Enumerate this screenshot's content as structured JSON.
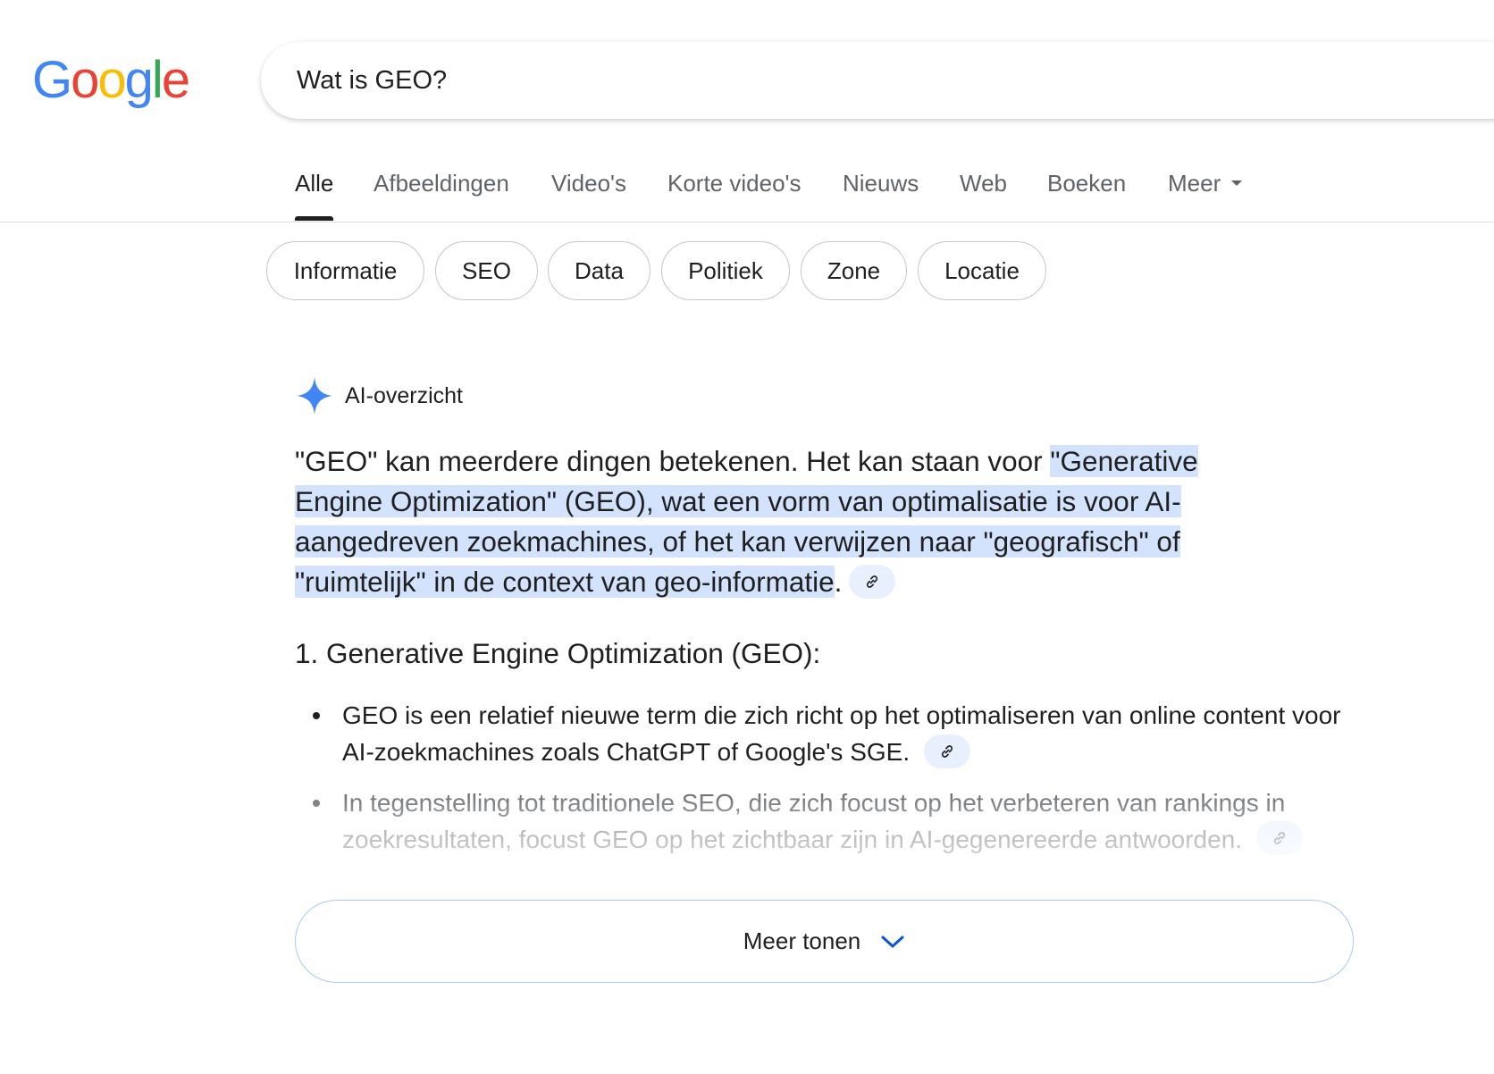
{
  "logo": {
    "letters": [
      {
        "ch": "G",
        "color": "#4285F4"
      },
      {
        "ch": "o",
        "color": "#EA4335"
      },
      {
        "ch": "o",
        "color": "#FBBC05"
      },
      {
        "ch": "g",
        "color": "#4285F4"
      },
      {
        "ch": "l",
        "color": "#34A853"
      },
      {
        "ch": "e",
        "color": "#EA4335"
      }
    ]
  },
  "search": {
    "query": "Wat is GEO?"
  },
  "tabs": [
    {
      "label": "Alle",
      "active": true
    },
    {
      "label": "Afbeeldingen"
    },
    {
      "label": "Video's"
    },
    {
      "label": "Korte video's"
    },
    {
      "label": "Nieuws"
    },
    {
      "label": "Web"
    },
    {
      "label": "Boeken"
    },
    {
      "label": "Meer"
    }
  ],
  "chips": [
    "Informatie",
    "SEO",
    "Data",
    "Politiek",
    "Zone",
    "Locatie"
  ],
  "ai_overview": {
    "label": "AI-overzicht",
    "icon": "sparkle-icon",
    "accent": "#4285F4",
    "paragraph": {
      "prefix": "\"GEO\" kan meerdere dingen betekenen. Het kan staan voor ",
      "highlight": "\"Generative Engine Optimization\" (GEO), wat een vorm van optimalisatie is voor AI-aangedreven zoekmachines, of het kan verwijzen naar \"geografisch\" of \"ruimtelijk\" in de context van geo-informatie",
      "suffix": "."
    },
    "heading": "1. Generative Engine Optimization (GEO):",
    "bullets": [
      "GEO is een relatief nieuwe term die zich richt op het optimaliseren van online content voor AI-zoekmachines zoals ChatGPT of Google's SGE.",
      "In tegenstelling tot traditionele SEO, die zich focust op het verbeteren van rankings in zoekresultaten, focust GEO op het zichtbaar zijn in AI-gegenereerde antwoorden."
    ],
    "show_more": "Meer tonen"
  }
}
